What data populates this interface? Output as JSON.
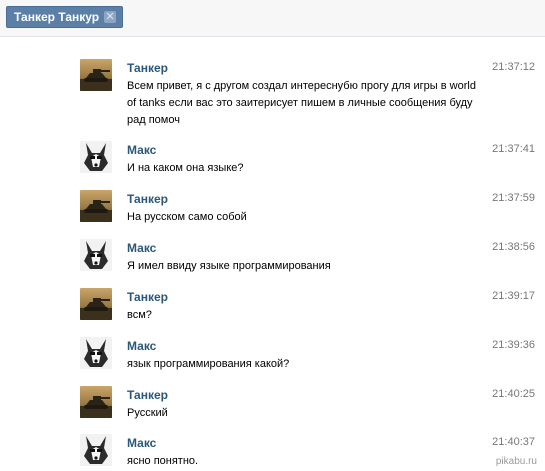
{
  "dialog": {
    "chip_label": "Танкер Танкур",
    "close_glyph": "✕"
  },
  "messages": [
    {
      "author": "Танкер",
      "time": "21:37:12",
      "text": "Всем привет, я с другом создал интереснубю прогу для игры в world of tanks если вас это заитерисует пишем в личные сообщения буду рад помоч",
      "avatar": "tank-avatar"
    },
    {
      "author": "Макс",
      "time": "21:37:41",
      "text": "И на каком она языке?",
      "avatar": "husky-avatar"
    },
    {
      "author": "Танкер",
      "time": "21:37:59",
      "text": "На русском само собой",
      "avatar": "tank-avatar"
    },
    {
      "author": "Макс",
      "time": "21:38:56",
      "text": "Я имел ввиду языке программирования",
      "avatar": "husky-avatar"
    },
    {
      "author": "Танкер",
      "time": "21:39:17",
      "text": "всм?",
      "avatar": "tank-avatar"
    },
    {
      "author": "Макс",
      "time": "21:39:36",
      "text": "язык программирования какой?",
      "avatar": "husky-avatar"
    },
    {
      "author": "Танкер",
      "time": "21:40:25",
      "text": "Русский",
      "avatar": "tank-avatar"
    },
    {
      "author": "Макс",
      "time": "21:40:37",
      "text": "ясно понятно.",
      "avatar": "husky-avatar"
    }
  ],
  "watermark": "pikabu.ru",
  "colors": {
    "chip_bg": "#5b7fa6",
    "author_link": "#2b587a",
    "timestamp": "#777777"
  }
}
